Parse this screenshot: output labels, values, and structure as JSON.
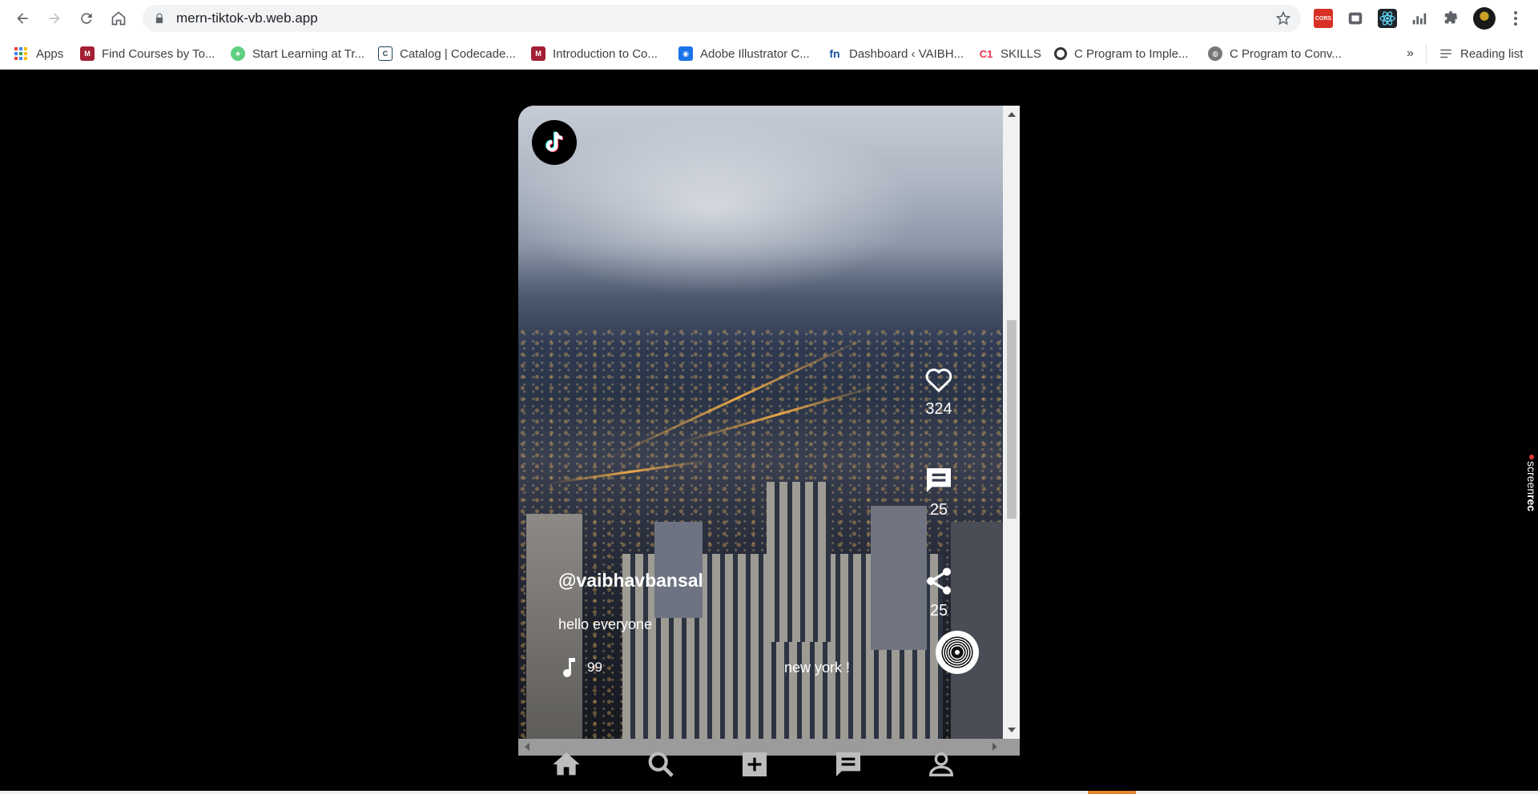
{
  "browser": {
    "url": "mern-tiktok-vb.web.app",
    "reading_list_label": "Reading list",
    "overflow_label": "»",
    "bookmarks": [
      {
        "label": "Apps",
        "icon": "apps-grid-icon"
      },
      {
        "label": "Find Courses by To...",
        "icon": "mit-ocw-icon"
      },
      {
        "label": "Start Learning at Tr...",
        "icon": "treehouse-icon"
      },
      {
        "label": "Catalog | Codecade...",
        "icon": "codecademy-icon"
      },
      {
        "label": "Introduction to Co...",
        "icon": "mit-ocw-icon"
      },
      {
        "label": "Adobe Illustrator C...",
        "icon": "adobe-icon"
      },
      {
        "label": "Dashboard ‹ VAIBH...",
        "icon": "fn-icon"
      },
      {
        "label": "SKILLS",
        "icon": "c1-icon"
      },
      {
        "label": "C Program to Imple...",
        "icon": "circle-icon"
      },
      {
        "label": "C Program to Conv...",
        "icon": "globe-icon"
      }
    ],
    "extensions": [
      {
        "name": "cors-extension-icon",
        "text": "CORS"
      },
      {
        "name": "extension-icon"
      },
      {
        "name": "react-devtools-icon"
      },
      {
        "name": "analytics-icon"
      },
      {
        "name": "puzzle-extensions-icon"
      }
    ]
  },
  "app": {
    "username": "@vaibhavbansal",
    "caption": "hello everyone",
    "music_text_left": "99",
    "music_text_right": "new york !",
    "likes": "324",
    "comments": "25",
    "shares": "25",
    "colors": {
      "background": "#000000",
      "icon_white": "#ffffff",
      "bottom_nav_icon": "#bdbdbd"
    }
  },
  "bottom_nav": [
    {
      "name": "home-icon"
    },
    {
      "name": "search-icon"
    },
    {
      "name": "add-box-icon"
    },
    {
      "name": "message-icon"
    },
    {
      "name": "profile-icon"
    }
  ],
  "watermark": {
    "light": "screen",
    "bold": "rec"
  }
}
